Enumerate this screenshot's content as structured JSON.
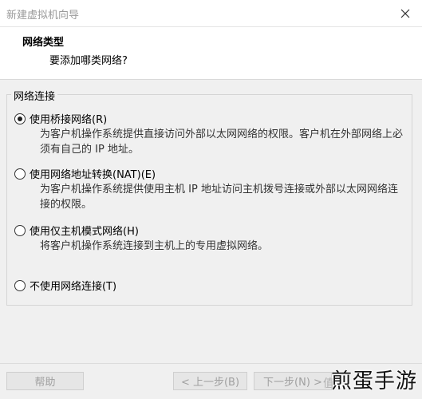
{
  "window": {
    "title": "新建虚拟机向导",
    "close_glyph": "✕"
  },
  "header": {
    "title": "网络类型",
    "subtitle": "要添加哪类网络?"
  },
  "group": {
    "legend": "网络连接",
    "options": [
      {
        "label": "使用桥接网络(R)",
        "selected": true,
        "description": "为客户机操作系统提供直接访问外部以太网网络的权限。客户机在外部网络上必须有自己的 IP 地址。"
      },
      {
        "label": "使用网络地址转换(NAT)(E)",
        "selected": false,
        "description": "为客户机操作系统提供使用主机 IP 地址访问主机拨号连接或外部以太网网络连接的权限。"
      },
      {
        "label": "使用仅主机模式网络(H)",
        "selected": false,
        "description": "将客户机操作系统连接到主机上的专用虚拟网络。"
      },
      {
        "label": "不使用网络连接(T)",
        "selected": false,
        "description": ""
      }
    ]
  },
  "footer": {
    "help_label": "帮助",
    "back_label": "< 上一步(B)",
    "next_label": "下一步(N) >"
  },
  "watermark": {
    "text": "煎蛋手游",
    "faint_text": "值"
  }
}
